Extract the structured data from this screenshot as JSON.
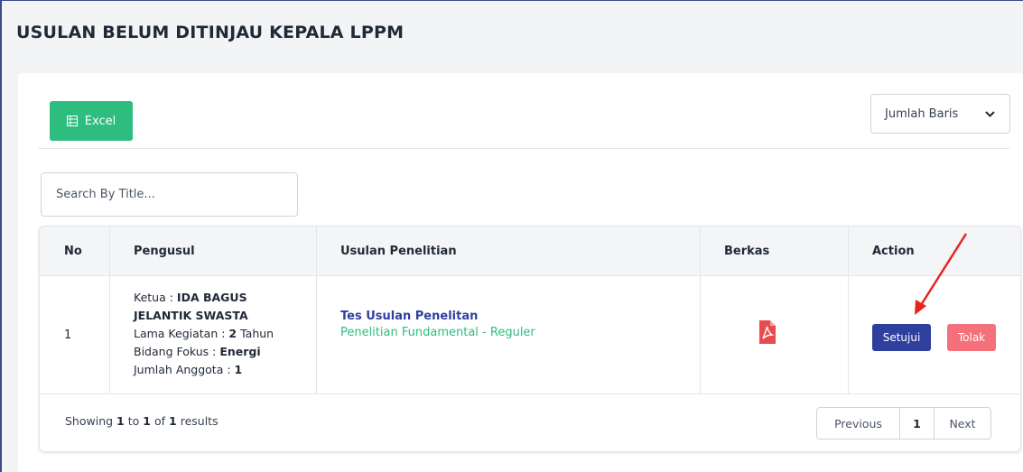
{
  "page": {
    "title": "USULAN BELUM DITINJAU KEPALA LPPM"
  },
  "toolbar": {
    "excel_label": "Excel",
    "rows_label": "Jumlah Baris"
  },
  "search": {
    "placeholder": "Search By Title..."
  },
  "table": {
    "headers": {
      "no": "No",
      "proposer": "Pengusul",
      "proposal": "Usulan Penelitian",
      "files": "Berkas",
      "action": "Action"
    },
    "rows": [
      {
        "no": "1",
        "leader_label": "Ketua :",
        "leader_name": "IDA BAGUS JELANTIK SWASTA",
        "duration_label": "Lama Kegiatan :",
        "duration_value": "2",
        "duration_unit": "Tahun",
        "focus_label": "Bidang Fokus :",
        "focus_value": "Energi",
        "members_label": "Jumlah Anggota :",
        "members_value": "1",
        "proposal_title": "Tes Usulan Penelitan",
        "proposal_scheme": "Penelitian Fundamental - Reguler",
        "file_icon": "pdf-icon",
        "approve_label": "Setujui",
        "reject_label": "Tolak"
      }
    ]
  },
  "footer": {
    "showing": "Showing",
    "from": "1",
    "to_word": "to",
    "to": "1",
    "of_word": "of",
    "total": "1",
    "results": "results"
  },
  "pagination": {
    "prev": "Previous",
    "current": "1",
    "next": "Next"
  },
  "colors": {
    "primary": "#2f3f9e",
    "success": "#2ebd7f",
    "danger": "#f4707a",
    "pdf": "#e84c4f",
    "annotation": "#e8231f"
  }
}
